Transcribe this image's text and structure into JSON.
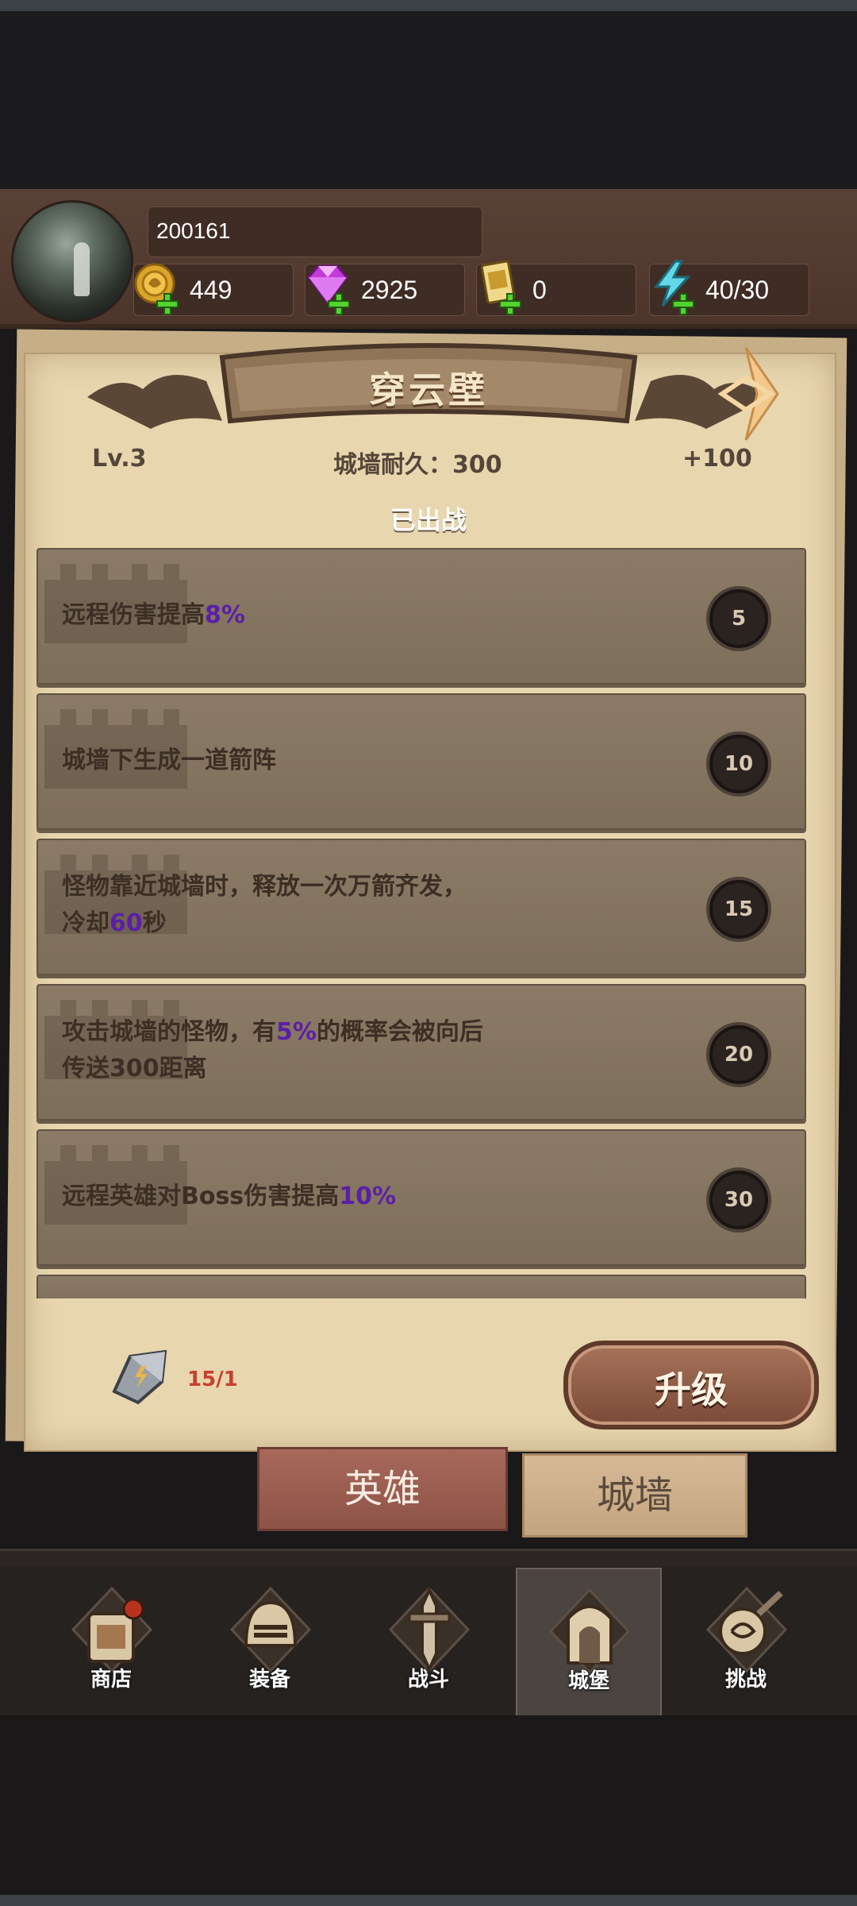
{
  "profile": {
    "user_id": "200161"
  },
  "resources": [
    {
      "name": "gold",
      "value": "449",
      "icon": "gold-coin-icon"
    },
    {
      "name": "gems",
      "value": "2925",
      "icon": "gem-icon"
    },
    {
      "name": "tickets",
      "value": "0",
      "icon": "ticket-icon"
    },
    {
      "name": "energy",
      "value": "40/30",
      "icon": "lightning-icon"
    }
  ],
  "wall_panel": {
    "title": "穿云壁",
    "level": "Lv.3",
    "durability": "城墙耐久：300",
    "bonus": "+100",
    "status": "已出战",
    "perks": [
      {
        "pre": "远程伤害提高",
        "hl": "8%",
        "post": "",
        "line2_pre": "",
        "line2_hl": "",
        "line2_post": "",
        "level": "5"
      },
      {
        "pre": "城墙下生成一道箭阵",
        "hl": "",
        "post": "",
        "line2_pre": "",
        "line2_hl": "",
        "line2_post": "",
        "level": "10"
      },
      {
        "pre": "怪物靠近城墙时，释放一次万箭齐发，",
        "hl": "",
        "post": "",
        "line2_pre": "冷却",
        "line2_hl": "60",
        "line2_post": "秒",
        "level": "15"
      },
      {
        "pre": "攻击城墙的怪物，有",
        "hl": "5%",
        "post": "的概率会被向后",
        "line2_pre": "传送300距离",
        "line2_hl": "",
        "line2_post": "",
        "level": "20"
      },
      {
        "pre": "远程英雄对Boss伤害提高",
        "hl": "10%",
        "post": "",
        "line2_pre": "",
        "line2_hl": "",
        "line2_post": "",
        "level": "30"
      }
    ],
    "material_count": "15/1",
    "upgrade_label": "升级"
  },
  "tabs": {
    "heroes": "英雄",
    "wall": "城墙"
  },
  "nav": [
    {
      "label": "商店",
      "icon": "shop-icon"
    },
    {
      "label": "装备",
      "icon": "equipment-helmet-icon"
    },
    {
      "label": "战斗",
      "icon": "battle-sword-icon"
    },
    {
      "label": "城堡",
      "icon": "castle-icon",
      "active": true
    },
    {
      "label": "挑战",
      "icon": "challenge-icon"
    }
  ],
  "colors": {
    "highlight": "#5b1fa6",
    "panel": "#e8d6af",
    "header": "#4c352b"
  }
}
